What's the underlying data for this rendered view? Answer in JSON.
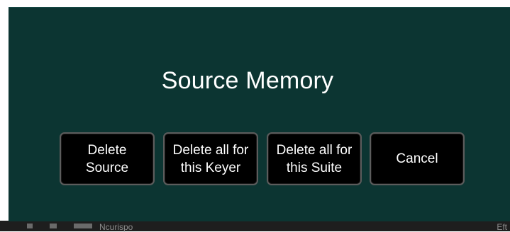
{
  "dialog": {
    "title": "Source Memory",
    "buttons": [
      {
        "line1": "Delete",
        "line2": "Source"
      },
      {
        "line1": "Delete all for",
        "line2": "this Keyer"
      },
      {
        "line1": "Delete all for",
        "line2": "this Suite"
      },
      {
        "line1": "Cancel",
        "line2": ""
      }
    ]
  },
  "background": {
    "partial_left_text": "Ncurispo",
    "partial_right_text": "Eft"
  },
  "colors": {
    "dialog_background": "#0c3532",
    "button_background": "#000000",
    "button_border": "#5c5c5c",
    "text": "#ffffff"
  }
}
